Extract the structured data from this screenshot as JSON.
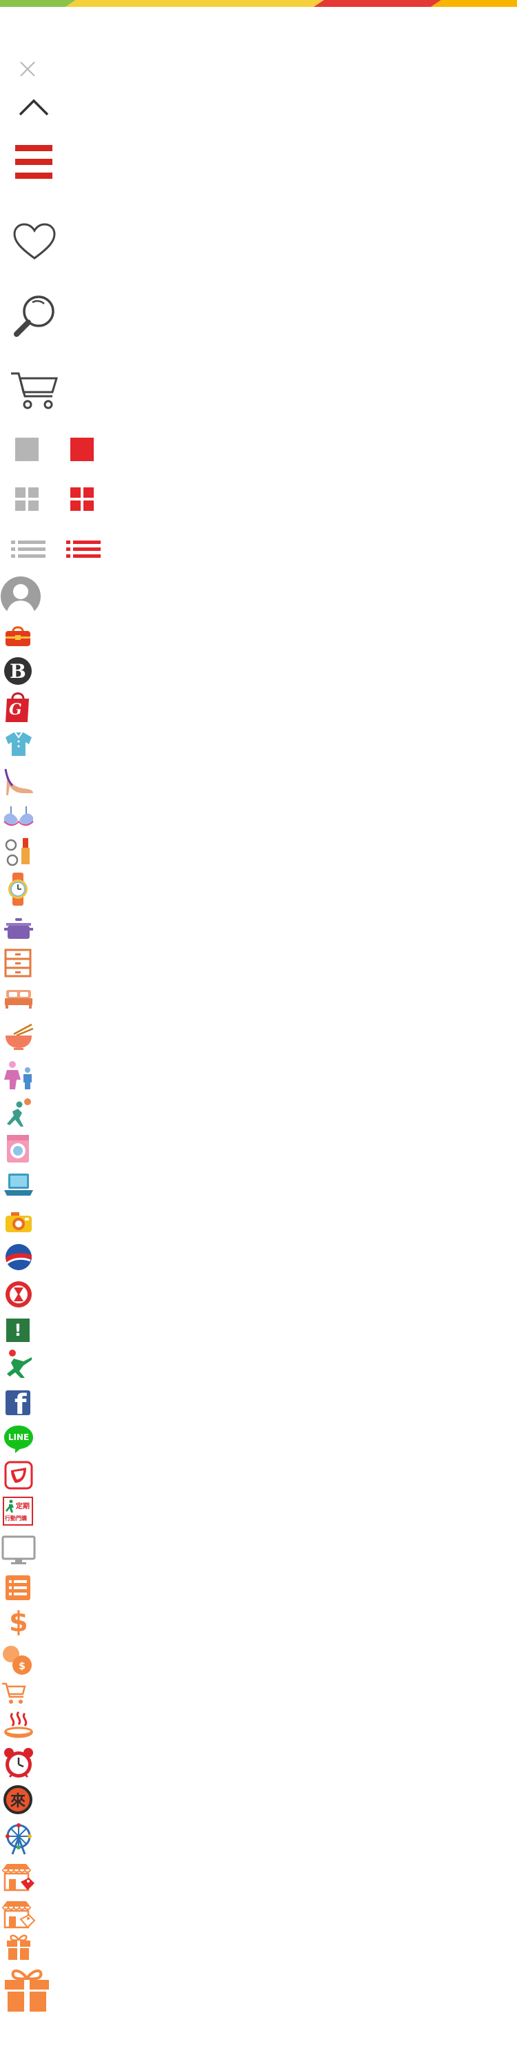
{
  "colors": {
    "top_bar": [
      "#8bc34a",
      "#f5d03c",
      "#f2c21a",
      "#e53935",
      "#f7b500"
    ],
    "accent_red": "#e4252a",
    "neutral_gray": "#b5b5b5",
    "icon_dark": "#444444",
    "icon_orange": "#f5873f",
    "facebook_blue": "#3b5a9a",
    "line_green": "#14c11a"
  },
  "icons": [
    "close-icon",
    "chevron-up-icon",
    "hamburger-menu-icon",
    "heart-icon",
    "search-icon",
    "shopping-cart-icon",
    "gray-square-icon",
    "red-square-icon",
    "gray-grid-icon",
    "red-grid-icon",
    "gray-list-icon",
    "red-list-icon",
    "avatar-icon",
    "handbag-icon",
    "b-badge-icon",
    "g-shopping-bag-icon",
    "shirt-icon",
    "high-heel-icon",
    "bra-icon",
    "cosmetics-icon",
    "watch-icon",
    "cooking-pot-icon",
    "drawer-cabinet-icon",
    "bed-icon",
    "noodle-bowl-icon",
    "kids-icon",
    "sports-icon",
    "washing-machine-icon",
    "laptop-icon",
    "camera-icon",
    "travel-globe-icon",
    "hourglass-badge-icon",
    "exclamation-icon",
    "runner-icon",
    "facebook-icon",
    "line-icon",
    "app-badge-icon",
    "regular-shopping-icon",
    "monitor-icon",
    "orange-list-icon",
    "dollar-icon",
    "coins-icon",
    "orange-cart-icon",
    "hot-spring-icon",
    "alarm-clock-icon",
    "lai-badge-icon",
    "ferris-wheel-icon",
    "store-tag-icon",
    "store-tag-alt-icon",
    "small-gift-icon",
    "large-gift-icon"
  ],
  "badges": {
    "b_letter": "B",
    "g_letter": "G",
    "exclamation": "!",
    "facebook_letter": "f",
    "line_label": "LINE",
    "dollar_sign": "$",
    "lai_char": "來",
    "regular_line1": "定期",
    "regular_line2": "行動門購"
  }
}
